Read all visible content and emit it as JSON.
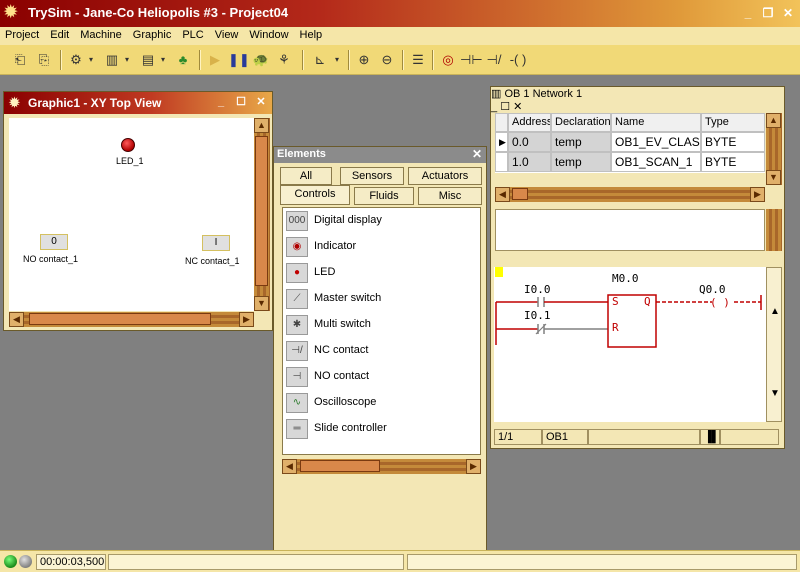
{
  "app": {
    "title": "TrySim - Jane-Co Heliopolis #3 - Project04"
  },
  "menu": [
    "Project",
    "Edit",
    "Machine",
    "Graphic",
    "PLC",
    "View",
    "Window",
    "Help"
  ],
  "graphic_window": {
    "title": "Graphic1 -  XY Top View",
    "led_label": "LED_1",
    "no_contact_value": "0",
    "no_contact_label": "NO contact_1",
    "nc_contact_value": "I",
    "nc_contact_label": "NC contact_1"
  },
  "elements_window": {
    "title": "Elements",
    "tabs_row1": [
      "All",
      "Sensors",
      "Actuators"
    ],
    "tabs_row2": [
      "Controls",
      "Fluids",
      "Misc"
    ],
    "active_tab": "Controls",
    "items": [
      {
        "label": "Digital display",
        "icon": "digital-display-icon",
        "glyph": "000"
      },
      {
        "label": "Indicator",
        "icon": "indicator-icon",
        "glyph": "◉"
      },
      {
        "label": "LED",
        "icon": "led-icon",
        "glyph": "●"
      },
      {
        "label": "Master switch",
        "icon": "master-switch-icon",
        "glyph": "⟋"
      },
      {
        "label": "Multi switch",
        "icon": "multi-switch-icon",
        "glyph": "✱"
      },
      {
        "label": "NC contact",
        "icon": "nc-contact-icon",
        "glyph": "⊣/"
      },
      {
        "label": "NO contact",
        "icon": "no-contact-icon",
        "glyph": "⊣"
      },
      {
        "label": "Oscilloscope",
        "icon": "oscilloscope-icon",
        "glyph": "∿"
      },
      {
        "label": "Slide controller",
        "icon": "slide-controller-icon",
        "glyph": "═"
      }
    ]
  },
  "ob_window": {
    "title": "OB  1 Network 1",
    "columns": [
      "Address",
      "Declaration",
      "Name",
      "Type"
    ],
    "rows": [
      {
        "address": "0.0",
        "declaration": "temp",
        "name": "OB1_EV_CLAS",
        "type": "BYTE"
      },
      {
        "address": "1.0",
        "declaration": "temp",
        "name": "OB1_SCAN_1",
        "type": "BYTE"
      }
    ],
    "ladder": {
      "input1": "I0.0",
      "input2": "I0.1",
      "flag": "M0.0",
      "set": "S",
      "reset": "R",
      "q": "Q",
      "output": "Q0.0",
      "coil": "( )"
    },
    "status_page": "1/1",
    "status_block": "OB1"
  },
  "statusbar": {
    "time": "00:00:03,500"
  }
}
